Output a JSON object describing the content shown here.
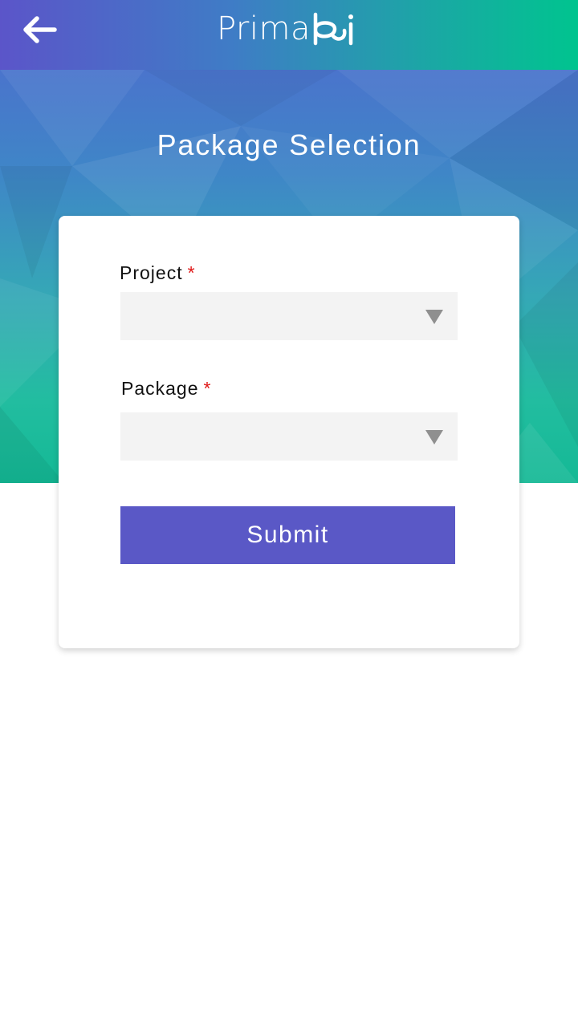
{
  "header": {
    "back_icon": "arrow-left-icon",
    "logo_text": "Prima",
    "logo_suffix": "bi"
  },
  "hero": {
    "title": "Package Selection"
  },
  "form": {
    "project": {
      "label": "Project",
      "required_mark": "*",
      "value": ""
    },
    "package": {
      "label": "Package",
      "required_mark": "*",
      "value": ""
    },
    "submit_label": "Submit"
  },
  "colors": {
    "header_gradient_start": "#5b55c9",
    "header_gradient_end": "#00c48f",
    "submit_button": "#5a58c6",
    "required_mark": "#e01818",
    "select_background": "#f3f3f3"
  }
}
